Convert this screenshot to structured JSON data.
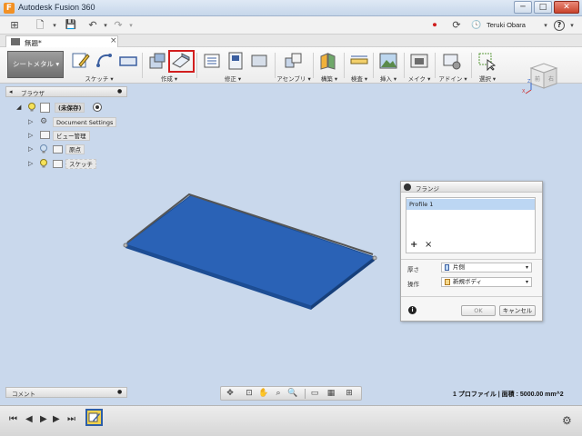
{
  "window": {
    "title": "Autodesk Fusion 360",
    "app_icon": "F",
    "min_label": "─",
    "max_label": "□",
    "close_label": "✕"
  },
  "qat": {
    "grid_glyph": "⊞",
    "file_glyph": "🗋",
    "save_glyph": "💾",
    "undo_glyph": "↶",
    "redo_glyph": "↷",
    "caret": "▾",
    "record_glyph": "⏺",
    "job_glyph": "⟳",
    "clock_glyph": "🕓",
    "user": "Teruki Obara",
    "user_caret": "▾",
    "help_glyph": "?"
  },
  "tab": {
    "label": "無題*",
    "close": "×"
  },
  "ribbon": {
    "workspace": "シートメタル ▾",
    "groups": [
      {
        "label": "スケッチ ▾"
      },
      {
        "label": "作成 ▾"
      },
      {
        "label": "修正 ▾"
      },
      {
        "label": "アセンブリ ▾"
      },
      {
        "label": "構築 ▾"
      },
      {
        "label": "検査 ▾"
      },
      {
        "label": "挿入 ▾"
      },
      {
        "label": "メイク ▾"
      },
      {
        "label": "アドイン ▾"
      },
      {
        "label": "選択 ▾"
      }
    ]
  },
  "browser": {
    "title": "ブラウザ",
    "collapse": "◂",
    "close": "●",
    "items": [
      {
        "label": "(未保存)",
        "arrow": "◢"
      },
      {
        "label": "Document Settings",
        "arrow": "▷"
      },
      {
        "label": "ビュー管理",
        "arrow": "▷"
      },
      {
        "label": "原点",
        "arrow": "▷"
      },
      {
        "label": "スケッチ",
        "arrow": "▷"
      }
    ]
  },
  "viewcube": {
    "face": "前",
    "side": "右",
    "axis_x": "X",
    "axis_z": "Z"
  },
  "flange": {
    "title": "フランジ",
    "profile": "Profile 1",
    "add": "+",
    "remove": "×",
    "thickness_label": "厚さ",
    "thickness_value": "片側",
    "operation_label": "操作",
    "operation_value": "新規ボディ",
    "info": "i",
    "ok": "OK",
    "cancel": "キャンセル",
    "caret": "▾"
  },
  "comments": {
    "label": "コメント",
    "close": "●"
  },
  "status": {
    "text": "1 プロファイル | 面積 : 5000.00 mm^2"
  },
  "timeline": {
    "first": "⏮",
    "prev": "◀",
    "play": "▶",
    "next": "▶",
    "last": "⏭",
    "gear": "⚙"
  },
  "colors": {
    "plate": "#2a62b6",
    "plate_edge": "#1b4a8c",
    "highlight": "#d21e1e",
    "selection": "#bcd6f3"
  }
}
